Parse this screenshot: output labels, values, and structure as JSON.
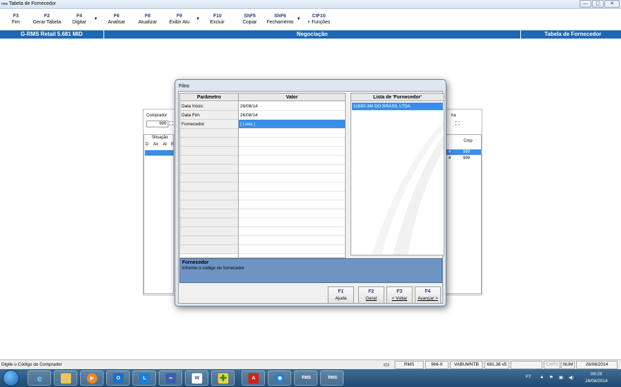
{
  "window": {
    "title": "Tabela de Fornecedor",
    "minimize_label": "—",
    "maximize_label": "▢",
    "close_label": "✕"
  },
  "toolbar": {
    "buttons": [
      {
        "key": "F3",
        "label": "Fim"
      },
      {
        "key": "F2",
        "label": "Gerar Tabela"
      },
      {
        "key": "F4",
        "label": "Digitar"
      },
      {
        "key": "F6",
        "label": "Analisar"
      },
      {
        "key": "F8",
        "label": "Atualizar"
      },
      {
        "key": "F9",
        "label": "Exibir Atu"
      },
      {
        "key": "F10",
        "label": "Excluir"
      },
      {
        "key": "ShF5",
        "label": "Copiar"
      },
      {
        "key": "ShF6",
        "label": "Fechamento"
      },
      {
        "key": "CtF10",
        "label": "+ Funções"
      }
    ],
    "dropdown_glyph": "▾"
  },
  "header": {
    "app": "G-RMS Retail 5.681 MID",
    "module": "Negociação",
    "screen": "Tabela de Fornecedor"
  },
  "background_form": {
    "comprador_label": "Comprador",
    "comprador_value": "999",
    "situacao_label": "Situação",
    "situacao_cols": [
      "D",
      "An",
      "At",
      "E"
    ],
    "right_label": "ha",
    "cmp_header": "Cmp",
    "rows": [
      {
        "left": "4",
        "cmp": "999"
      },
      {
        "left": "4",
        "cmp": "999"
      }
    ]
  },
  "dialog": {
    "title": "Filtro",
    "param_header": "Parâmetro",
    "value_header": "Valor",
    "params": [
      {
        "name": "Data Início",
        "value": "26/08/14"
      },
      {
        "name": "Data Fim",
        "value": "26/08/14"
      },
      {
        "name": "Fornecedor",
        "value": "( Lista )"
      }
    ],
    "list_header": "Lista de 'Fornecedor'",
    "list_items": [
      "11690-3M DO BRASIL LTDA"
    ],
    "help_title": "Fornecedor",
    "help_text": "Informe o código do fornecedor",
    "buttons": [
      {
        "key": "F1",
        "label": "Ajuda"
      },
      {
        "key": "F2",
        "label": "Geral"
      },
      {
        "key": "F3",
        "label": "< Voltar"
      },
      {
        "key": "F4",
        "label": "Avançar >"
      }
    ]
  },
  "statusbar": {
    "message": "Digite o Código do Comprador",
    "panes": [
      "RMS",
      "966-0",
      "VABUMNTB",
      "681.36 v5",
      "",
      "CAPS",
      "NUM",
      "26/08/2014"
    ]
  },
  "taskbar": {
    "apps": [
      "ie",
      "explorer",
      "media-player",
      "outlook",
      "lync",
      "remote",
      "word",
      "app-green",
      "acrobat",
      "network",
      "rms",
      "rms"
    ],
    "app_labels": {
      "outlook": "O",
      "lync": "L",
      "word": "W",
      "acrobat": "A",
      "rms1": "RMS",
      "rms2": "RMS"
    },
    "lang": "FT",
    "time": "09:29",
    "date": "26/08/2014"
  },
  "colors": {
    "header_blue": "#1d68b5",
    "selection_blue": "#3b8de5",
    "help_blue": "#6f94c4"
  }
}
